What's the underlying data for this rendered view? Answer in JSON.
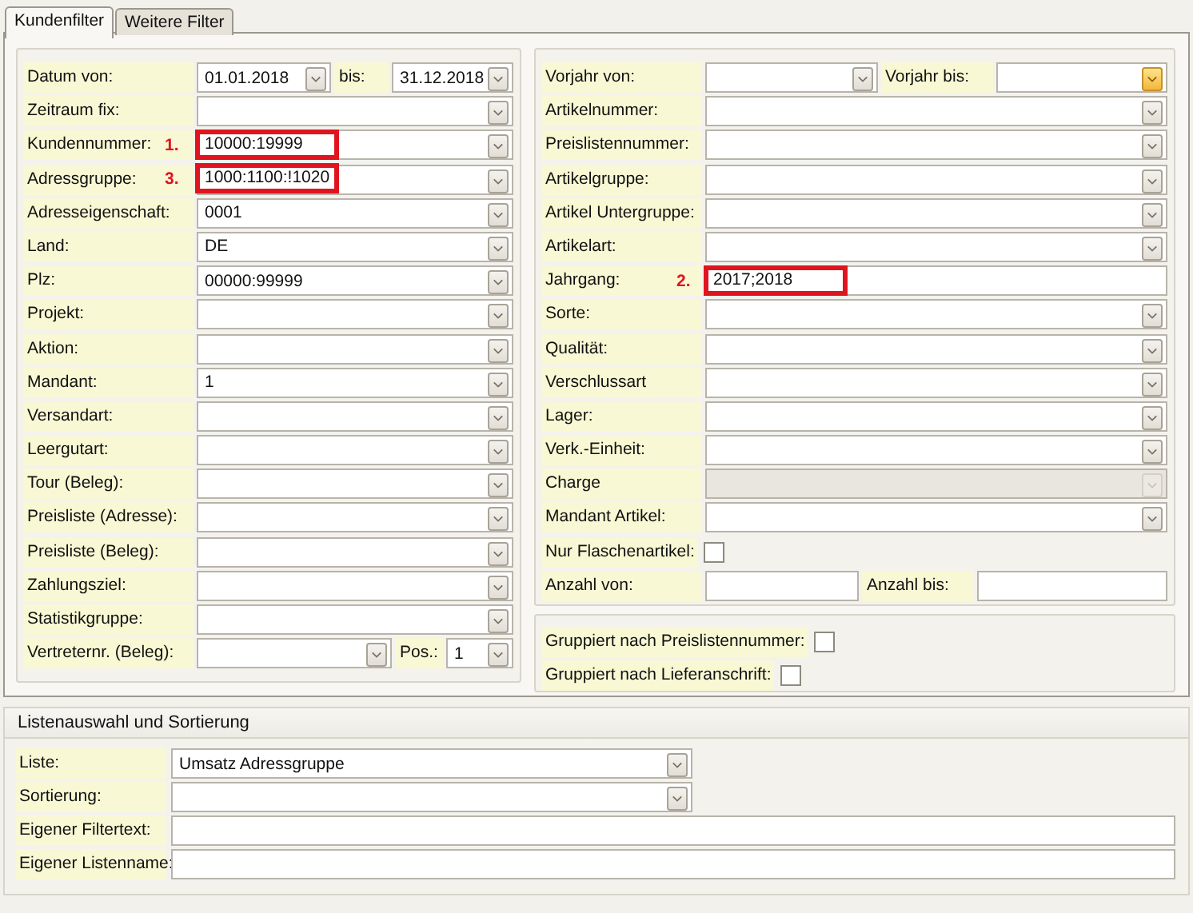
{
  "tabs": [
    {
      "label": "Kundenfilter",
      "selected": true
    },
    {
      "label": "Weitere Filter",
      "selected": false
    }
  ],
  "left_filters": [
    {
      "label": "Datum von:",
      "kind": "combo",
      "value": "01.01.2018",
      "second": {
        "label": "bis:",
        "kind": "combo",
        "value": "31.12.2018"
      }
    },
    {
      "label": "Zeitraum fix:",
      "kind": "combo"
    },
    {
      "label": "Kundennummer:",
      "kind": "combo",
      "value": "10000:19999",
      "annotation": "1."
    },
    {
      "label": "Adressgruppe:",
      "kind": "combo",
      "value": "1000:1100:!1020",
      "annotation": "3."
    },
    {
      "label": "Adresseigenschaft:",
      "kind": "combo",
      "value": "0001"
    },
    {
      "label": "Land:",
      "kind": "combo",
      "value": "DE"
    },
    {
      "label": "Plz:",
      "kind": "combo",
      "value": "00000:99999"
    },
    {
      "label": "Projekt:",
      "kind": "combo"
    },
    {
      "label": "Aktion:",
      "kind": "combo"
    },
    {
      "label": "Mandant:",
      "kind": "combo",
      "value": "1"
    },
    {
      "label": "Versandart:",
      "kind": "combo"
    },
    {
      "label": "Leergutart:",
      "kind": "combo"
    },
    {
      "label": "Tour (Beleg):",
      "kind": "combo"
    },
    {
      "label": "Preisliste (Adresse):",
      "kind": "combo"
    },
    {
      "label": "Preisliste (Beleg):",
      "kind": "combo"
    },
    {
      "label": "Zahlungsziel:",
      "kind": "combo"
    },
    {
      "label": "Statistikgruppe:",
      "kind": "combo"
    },
    {
      "label": "Vertreternr. (Beleg):",
      "kind": "combo",
      "second": {
        "label": "Pos.:",
        "kind": "combo",
        "value": "1"
      }
    }
  ],
  "right_filters": [
    {
      "label": "Vorjahr von:",
      "kind": "combo",
      "second": {
        "label": "Vorjahr bis:",
        "kind": "combo",
        "hover": true
      }
    },
    {
      "label": "Artikelnummer:",
      "kind": "combo"
    },
    {
      "label": "Preislistennummer:",
      "kind": "combo"
    },
    {
      "label": "Artikelgruppe:",
      "kind": "combo"
    },
    {
      "label": "Artikel Untergruppe:",
      "kind": "combo"
    },
    {
      "label": "Artikelart:",
      "kind": "combo"
    },
    {
      "label": "Jahrgang:",
      "kind": "text",
      "value": "2017;2018",
      "annotation": "2."
    },
    {
      "label": "Sorte:",
      "kind": "combo"
    },
    {
      "label": "Qualität:",
      "kind": "combo"
    },
    {
      "label": "Verschlussart",
      "kind": "combo"
    },
    {
      "label": "Lager:",
      "kind": "combo"
    },
    {
      "label": "Verk.-Einheit:",
      "kind": "combo"
    },
    {
      "label": "Charge",
      "kind": "combo",
      "disabled": true
    },
    {
      "label": "Mandant Artikel:",
      "kind": "combo"
    },
    {
      "label": "Nur Flaschenartikel:",
      "kind": "checkbox",
      "checked": false
    },
    {
      "label": "Anzahl von:",
      "kind": "text",
      "second": {
        "label": "Anzahl bis:",
        "kind": "text"
      }
    }
  ],
  "grouping": [
    {
      "label": "Gruppiert nach Preislistennummer:",
      "kind": "checkbox",
      "checked": false
    },
    {
      "label": "Gruppiert nach Lieferanschrift:",
      "kind": "checkbox",
      "checked": false
    }
  ],
  "list_section": {
    "title": "Listenauswahl und Sortierung",
    "rows": [
      {
        "label": "Liste:",
        "kind": "combo",
        "value": "Umsatz Adressgruppe"
      },
      {
        "label": "Sortierung:",
        "kind": "combo"
      },
      {
        "label": "Eigener Filtertext:",
        "kind": "text"
      },
      {
        "label": "Eigener Listenname:",
        "kind": "text"
      }
    ]
  }
}
